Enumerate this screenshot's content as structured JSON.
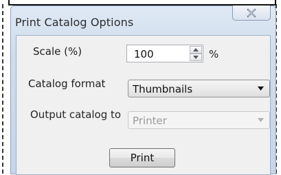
{
  "window": {
    "title": "Print Catalog Options"
  },
  "form": {
    "scale": {
      "label": "Scale (%)",
      "value": "100",
      "unit": "%"
    },
    "catalog_format": {
      "label": "Catalog format",
      "selected": "Thumbnails"
    },
    "output_catalog_to": {
      "label": "Output catalog to",
      "selected": "Printer",
      "disabled": true
    },
    "print_button": {
      "label": "Print"
    }
  },
  "colors": {
    "title_bar": "#cfdcec",
    "client_background": "#f0f0f0",
    "close_glyph": "#5a6b82",
    "disabled_text": "#9a9a9a"
  },
  "icons": {
    "close": "close-icon",
    "spin_up": "spin-up-icon",
    "spin_down": "spin-down-icon",
    "dropdown": "chevron-down-icon"
  }
}
